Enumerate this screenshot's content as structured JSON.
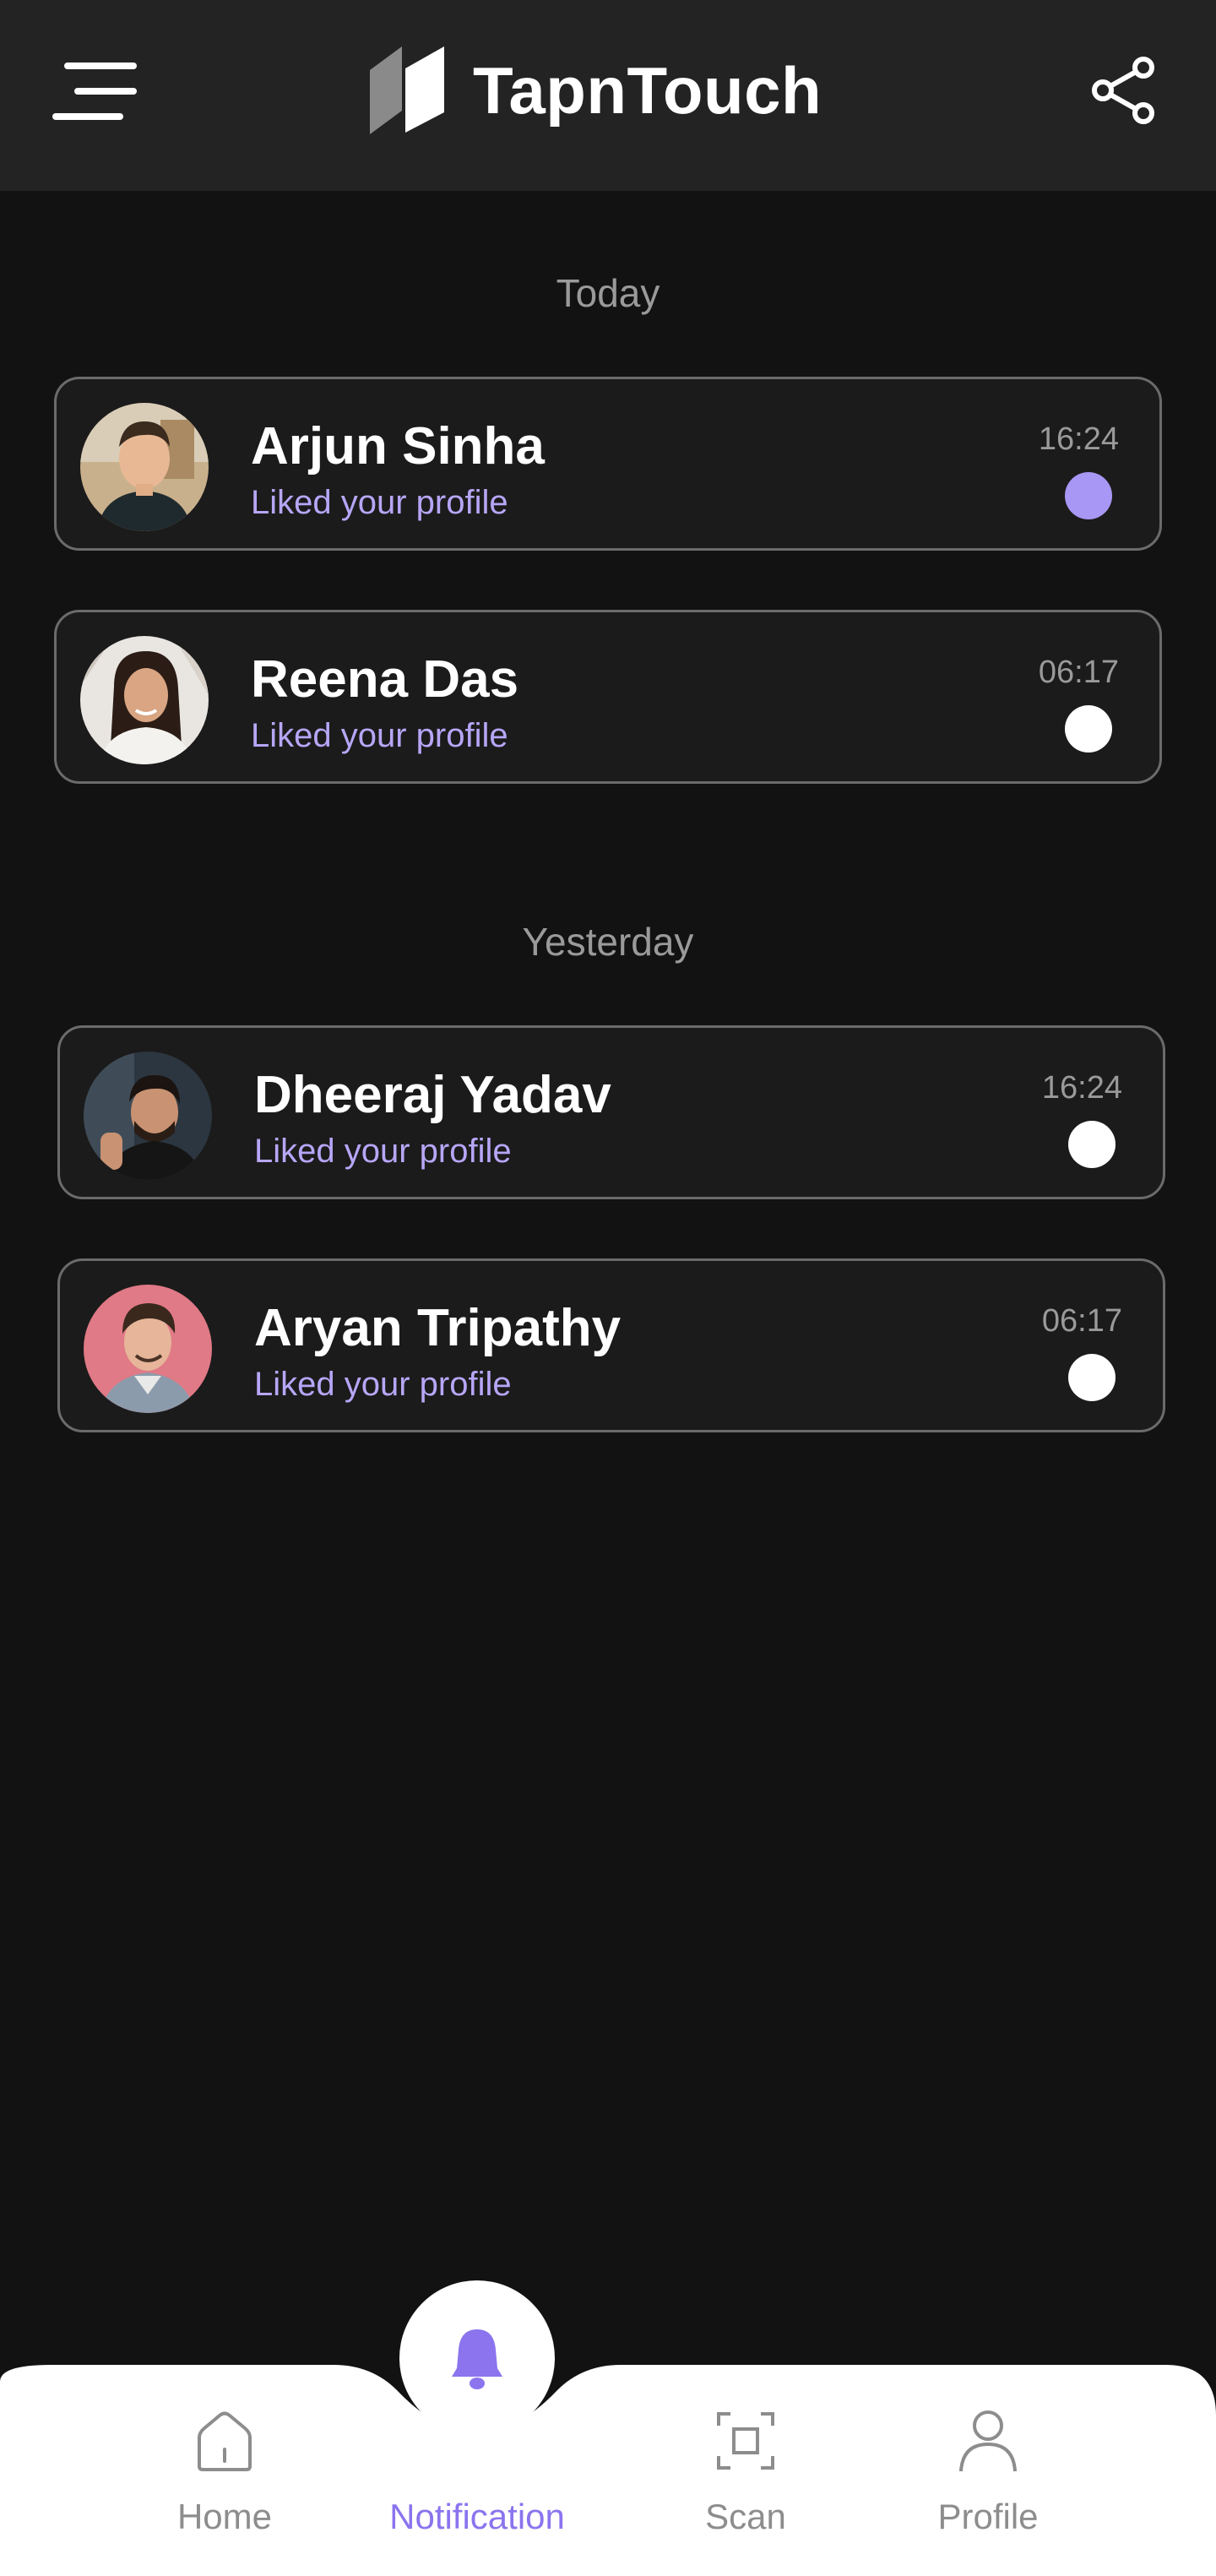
{
  "header": {
    "title": "TapnTouch",
    "menu_icon": "menu-icon",
    "share_icon": "share-icon"
  },
  "sections": [
    {
      "heading": "Today",
      "notifications": [
        {
          "name": "Arjun Sinha",
          "message": "Liked your profile",
          "time": "16:24",
          "unread": true
        },
        {
          "name": "Reena Das",
          "message": "Liked your profile",
          "time": "06:17",
          "unread": false
        }
      ]
    },
    {
      "heading": "Yesterday",
      "notifications": [
        {
          "name": "Dheeraj Yadav",
          "message": "Liked your profile",
          "time": "16:24",
          "unread": false
        },
        {
          "name": "Aryan Tripathy",
          "message": "Liked your profile",
          "time": "06:17",
          "unread": false
        }
      ]
    }
  ],
  "bottom_nav": {
    "items": [
      {
        "label": "Home",
        "icon": "home-icon",
        "active": false
      },
      {
        "label": "Notification",
        "icon": "bell-icon",
        "active": true
      },
      {
        "label": "Scan",
        "icon": "scan-icon",
        "active": false
      },
      {
        "label": "Profile",
        "icon": "user-icon",
        "active": false
      }
    ]
  },
  "colors": {
    "background": "#121212",
    "header": "#232323",
    "accent": "#8b74ee",
    "subtext": "#b7a6f7",
    "unread_dot": "#a997f5",
    "read_dot": "#ffffff"
  }
}
